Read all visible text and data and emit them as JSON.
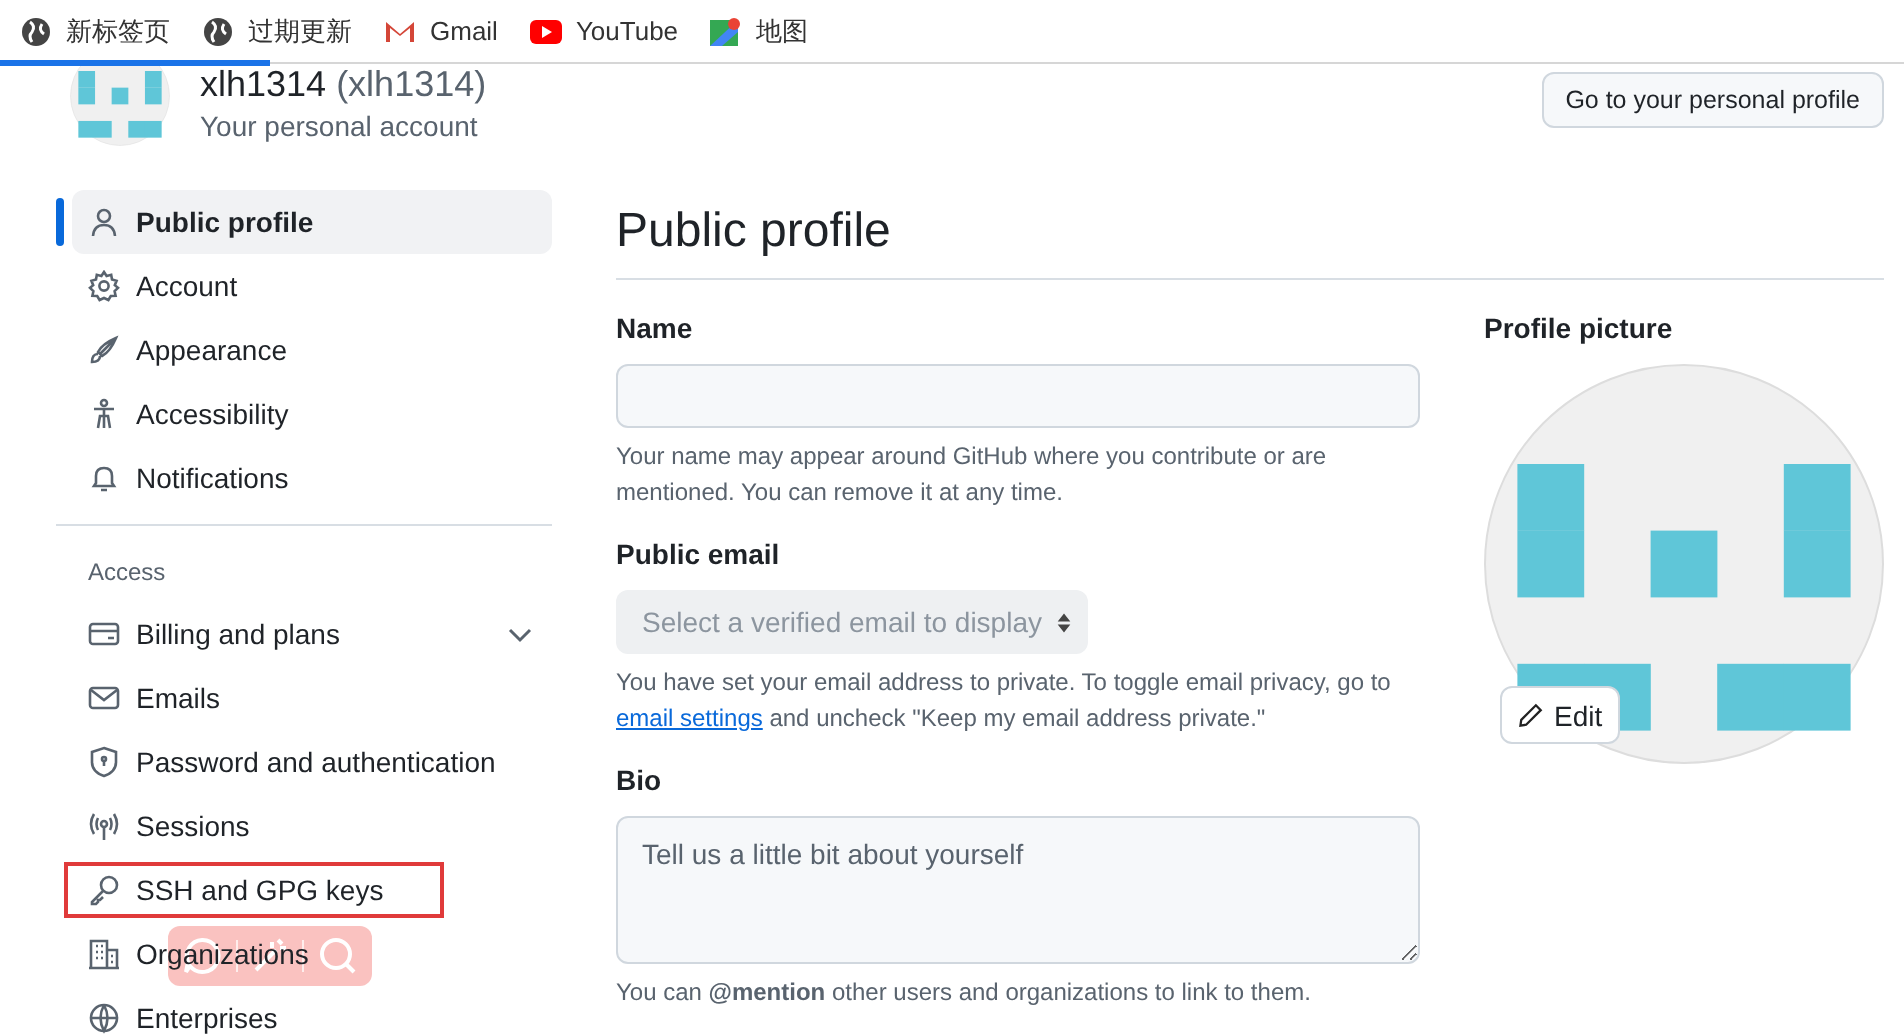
{
  "bookmarks": [
    {
      "label": "新标签页",
      "kind": "globe"
    },
    {
      "label": "过期更新",
      "kind": "globe"
    },
    {
      "label": "Gmail",
      "kind": "mail"
    },
    {
      "label": "YouTube",
      "kind": "video"
    },
    {
      "label": "地图",
      "kind": "map"
    }
  ],
  "loading": {
    "level": 0.142
  },
  "account": {
    "name": "xlh1314",
    "login": "(xlh1314)",
    "subtitle": "Your personal account"
  },
  "profile_button": "Go to your personal profile",
  "sidebar": {
    "items": [
      {
        "label": "Public profile",
        "selected": true
      },
      {
        "label": "Account",
        "selected": false
      },
      {
        "label": "Appearance",
        "selected": false
      },
      {
        "label": "Accessibility",
        "selected": false
      },
      {
        "label": "Notifications",
        "selected": false
      }
    ],
    "access": {
      "heading": "Access",
      "items": [
        {
          "label": "Billing and plans",
          "kind": "group",
          "highlighted": false
        },
        {
          "label": "Emails",
          "kind": "link",
          "highlighted": false
        },
        {
          "label": "Password and authentication",
          "kind": "link",
          "highlighted": false
        },
        {
          "label": "Sessions",
          "kind": "link",
          "highlighted": false
        },
        {
          "label": "SSH and GPG keys",
          "kind": "link",
          "highlighted": true
        },
        {
          "label": "Organizations",
          "kind": "link",
          "highlighted": false
        },
        {
          "label": "Enterprises",
          "kind": "link",
          "highlighted": false
        }
      ]
    }
  },
  "main": {
    "title": "Public profile",
    "name": {
      "label": "Name",
      "help": "Your name may appear around GitHub where you contribute or are mentioned. You can remove it at any time."
    },
    "public_email": {
      "label": "Public email",
      "placeholder": "Select a verified email to display",
      "help_before": "You have set your email address to private. To toggle email privacy, go to",
      "help_link": "email settings",
      "help_after": "and uncheck \"Keep my email address private.\""
    },
    "bio": {
      "label": "Bio",
      "placeholder": "Tell us a little bit about yourself",
      "help": "You can **@mention** other users and organizations to link to them."
    },
    "profile_picture": {
      "label": "Profile picture",
      "edit_button": "Edit"
    }
  }
}
